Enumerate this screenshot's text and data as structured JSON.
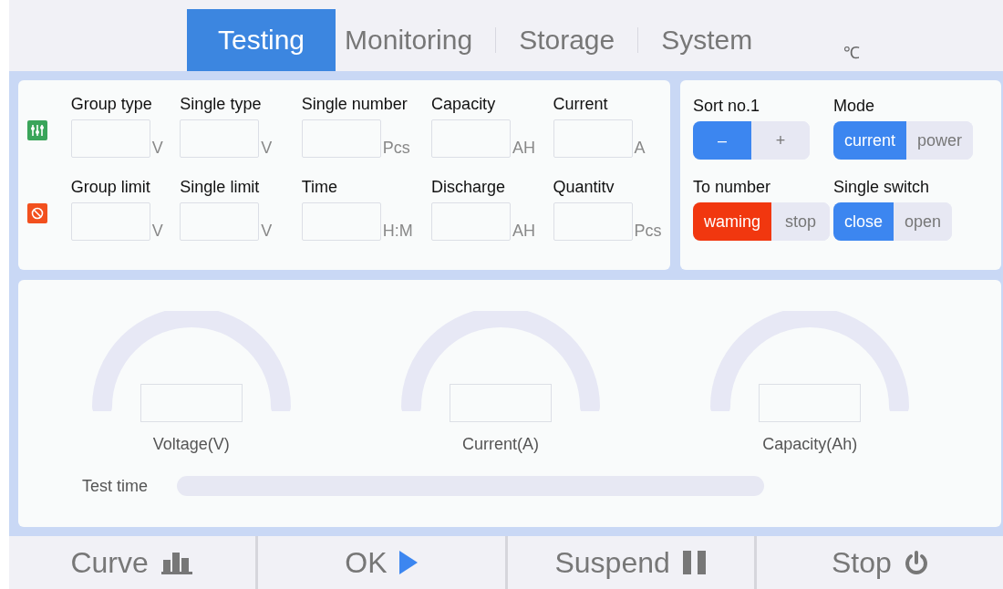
{
  "tabs": [
    {
      "label": "Testing",
      "selected": true
    },
    {
      "label": "Monitoring",
      "selected": false
    },
    {
      "label": "Storage",
      "selected": false
    },
    {
      "label": "System",
      "selected": false
    }
  ],
  "temperature_unit": "℃",
  "parameter_rows": [
    {
      "kind": "sliders",
      "fields": [
        {
          "label": "Group type",
          "unit": "V"
        },
        {
          "label": "Single type",
          "unit": "V"
        },
        {
          "label": "Single number",
          "unit": "Pcs"
        },
        {
          "label": "Capacity",
          "unit": "AH"
        },
        {
          "label": "Current",
          "unit": "A"
        }
      ]
    },
    {
      "kind": "forbidden",
      "fields": [
        {
          "label": "Group limit",
          "unit": "V"
        },
        {
          "label": "Single limit",
          "unit": "V"
        },
        {
          "label": "Time",
          "unit": "H:M"
        },
        {
          "label": "Discharge",
          "unit": "AH"
        },
        {
          "label": "Quantitv",
          "unit": "Pcs"
        }
      ]
    }
  ],
  "controls": [
    {
      "label": "Sort no.1",
      "kind": "normal",
      "options": [
        {
          "label": "–",
          "selected": true
        },
        {
          "label": "+",
          "selected": false
        }
      ]
    },
    {
      "label": "Mode",
      "kind": "normal",
      "options": [
        {
          "label": "current",
          "selected": true
        },
        {
          "label": "power",
          "selected": false
        }
      ]
    },
    {
      "label": "To number",
      "kind": "alert",
      "options": [
        {
          "label": "waming",
          "selected": true
        },
        {
          "label": "stop",
          "selected": false
        }
      ]
    },
    {
      "label": "Single switch",
      "kind": "normal",
      "options": [
        {
          "label": "close",
          "selected": true
        },
        {
          "label": "open",
          "selected": false
        }
      ]
    }
  ],
  "gauges": [
    {
      "label": "Voltage(V)"
    },
    {
      "label": "Current(A)"
    },
    {
      "label": "Capacity(Ah)"
    }
  ],
  "test_time": {
    "label": "Test time"
  },
  "actions": [
    {
      "label": "Curve",
      "kind": "chart"
    },
    {
      "label": "OK",
      "kind": "play"
    },
    {
      "label": "Suspend",
      "kind": "pause"
    },
    {
      "label": "Stop",
      "kind": "power"
    }
  ]
}
